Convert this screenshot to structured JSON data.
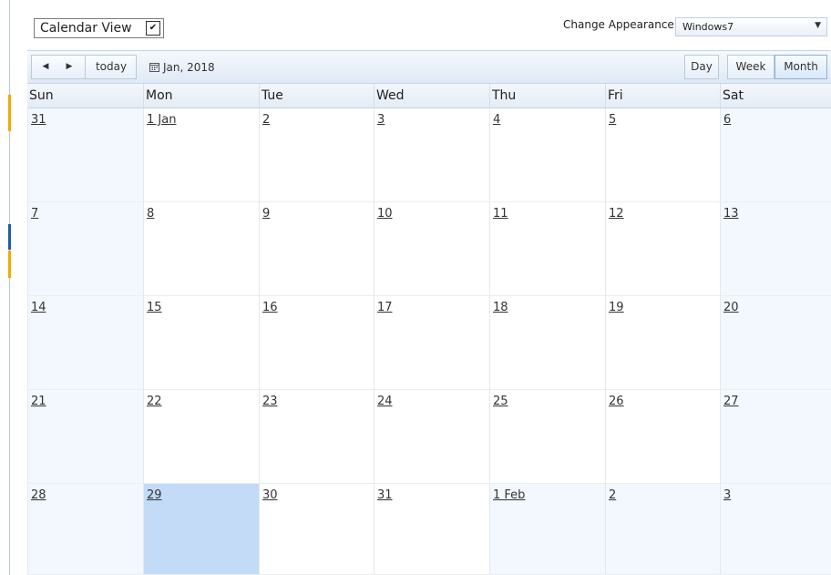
{
  "view_selector": {
    "value": "Calendar View"
  },
  "appearance": {
    "label": "Change Appearance:",
    "value": "Windows7"
  },
  "toolbar": {
    "prev_icon": "prev-arrow-icon",
    "next_icon": "next-arrow-icon",
    "today_label": "today",
    "date_label": "Jan, 2018",
    "views": [
      {
        "label": "Day",
        "active": false
      },
      {
        "label": "Week",
        "active": false
      },
      {
        "label": "Month",
        "active": true
      }
    ]
  },
  "calendar": {
    "days_of_week": [
      "Sun",
      "Mon",
      "Tue",
      "Wed",
      "Thu",
      "Fri",
      "Sat"
    ],
    "weeks": [
      [
        "31",
        "1 Jan",
        "2",
        "3",
        "4",
        "5",
        "6"
      ],
      [
        "7",
        "8",
        "9",
        "10",
        "11",
        "12",
        "13"
      ],
      [
        "14",
        "15",
        "16",
        "17",
        "18",
        "19",
        "20"
      ],
      [
        "21",
        "22",
        "23",
        "24",
        "25",
        "26",
        "27"
      ],
      [
        "28",
        "29",
        "30",
        "31",
        "1 Feb",
        "2",
        "3"
      ]
    ],
    "today": "29"
  },
  "colors": {
    "today_highlight": "#c3dbf7",
    "weekend_background": "#f2f8fd",
    "toolbar_gradient_end": "#dfe9f5"
  }
}
